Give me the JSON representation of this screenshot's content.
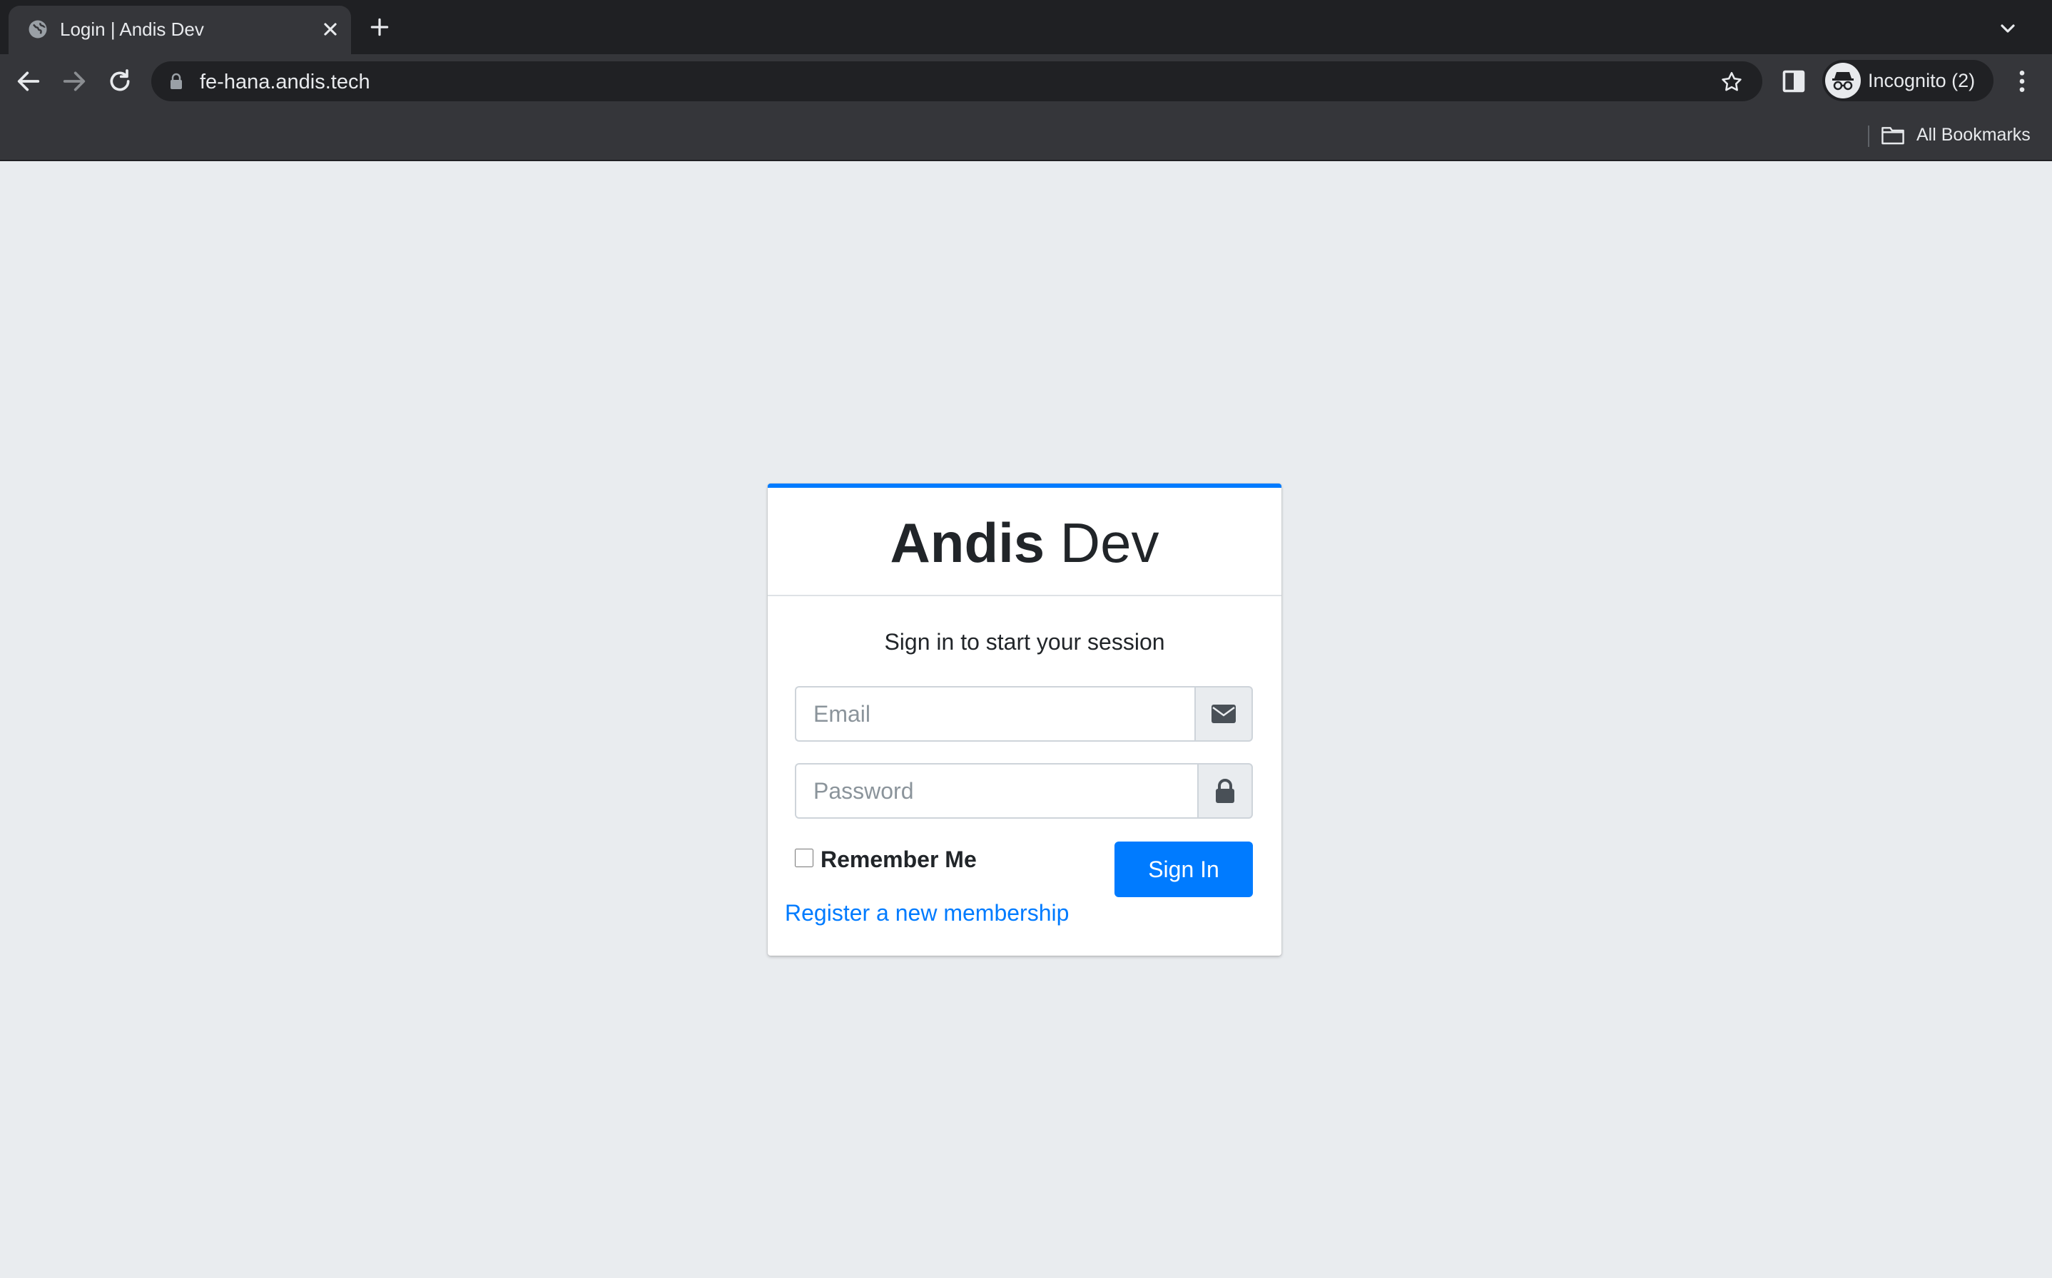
{
  "browser": {
    "tab_title": "Login | Andis Dev",
    "url": "fe-hana.andis.tech",
    "profile_label": "Incognito (2)",
    "bookmarks_label": "All Bookmarks"
  },
  "login": {
    "brand_bold": "Andis",
    "brand_light": " Dev",
    "subtitle": "Sign in to start your session",
    "email_placeholder": "Email",
    "password_placeholder": "Password",
    "remember_label": "Remember Me",
    "signin_label": "Sign In",
    "register_link": "Register a new membership"
  },
  "colors": {
    "accent": "#007bff",
    "page_bg": "#e9ecef",
    "chrome_dark": "#1f2023",
    "chrome_toolbar": "#35363a"
  },
  "icons": [
    "globe-icon",
    "close-icon",
    "plus-icon",
    "chevron-down-icon",
    "back-arrow-icon",
    "forward-arrow-icon",
    "reload-icon",
    "lock-icon",
    "star-icon",
    "side-panel-icon",
    "incognito-icon",
    "more-vert-icon",
    "folder-icon",
    "envelope-icon",
    "padlock-icon"
  ]
}
